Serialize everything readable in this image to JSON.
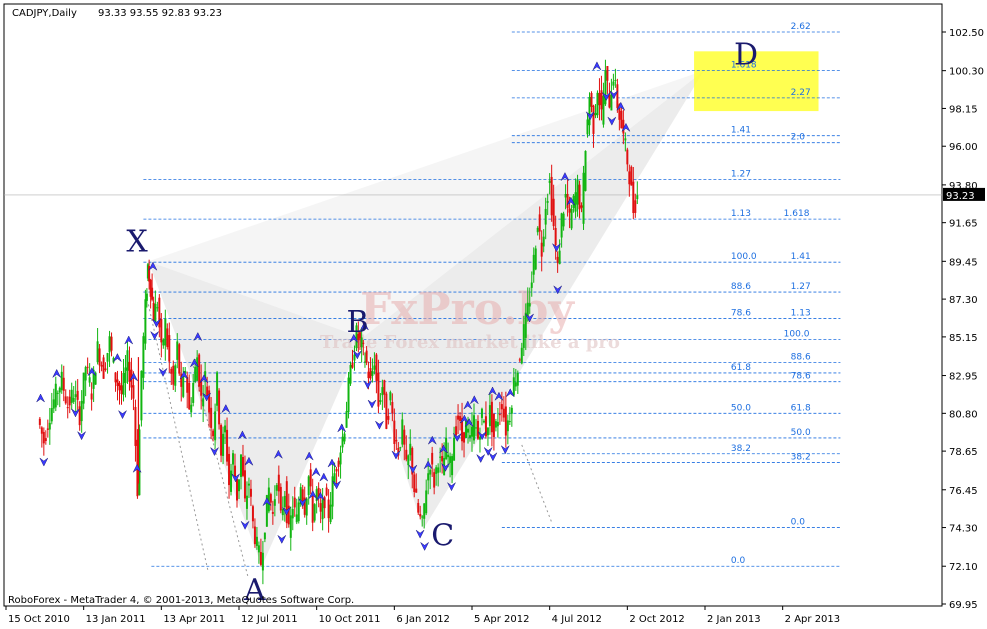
{
  "chart_data": {
    "type": "candlestick",
    "header": {
      "symbol": "CADJPY,Daily",
      "ohlc": "93.33 93.55 92.83 93.23"
    },
    "footer": "RoboForex - MetaTrader 4, © 2001-2013, MetaQuotes Software Corp.",
    "watermark": {
      "main": "FxPro.by",
      "sub": "Trade Forex market like a pro"
    },
    "ylim": [
      69.95,
      103.5
    ],
    "xlim": [
      0,
      940
    ],
    "y_ticks": [
      102.5,
      100.3,
      98.15,
      96.0,
      93.8,
      91.65,
      89.45,
      87.3,
      85.15,
      82.95,
      80.8,
      78.65,
      76.45,
      74.3,
      72.1,
      69.95
    ],
    "y_tick_labels": [
      "102.50",
      "100.30",
      "98.15",
      "96.00",
      "93.80",
      "91.65",
      "89.45",
      "87.30",
      "85.15",
      "82.95",
      "80.80",
      "78.65",
      "76.45",
      "74.30",
      "72.10",
      "69.95"
    ],
    "x_ticks": [
      {
        "label": "15 Oct 2010",
        "x": 0
      },
      {
        "label": "13 Jan 2011",
        "x": 65
      },
      {
        "label": "13 Apr 2011",
        "x": 130
      },
      {
        "label": "12 Jul 2011",
        "x": 195
      },
      {
        "label": "10 Oct 2011",
        "x": 260
      },
      {
        "label": "6 Jan 2012",
        "x": 325
      },
      {
        "label": "5 Apr 2012",
        "x": 390
      },
      {
        "label": "4 Jul 2012",
        "x": 455
      },
      {
        "label": "2 Oct 2012",
        "x": 520
      },
      {
        "label": "2 Jan 2013",
        "x": 585
      },
      {
        "label": "2 Apr 2013",
        "x": 650
      }
    ],
    "current_price": "93.23",
    "wave_points": [
      {
        "label": "X",
        "x": 110,
        "y": 89.45
      },
      {
        "label": "A",
        "x": 224,
        "y": 72.1
      },
      {
        "label": "B",
        "x": 325,
        "y": 85.1
      },
      {
        "label": "C",
        "x": 386,
        "y": 74.2
      },
      {
        "label": "D",
        "x": 668,
        "y": 100.3
      }
    ],
    "fib_lines": [
      {
        "level": 102.5,
        "labels": [
          {
            "text": "2.62",
            "x": 700
          }
        ]
      },
      {
        "level": 100.3,
        "labels": [
          {
            "text": "1.618",
            "x": 640
          }
        ]
      },
      {
        "level": 98.75,
        "labels": [
          {
            "text": "2.27",
            "x": 700
          }
        ]
      },
      {
        "level": 96.6,
        "labels": [
          {
            "text": "1.41",
            "x": 640
          }
        ]
      },
      {
        "level": 96.2,
        "labels": [
          {
            "text": "2.0",
            "x": 700
          }
        ]
      },
      {
        "level": 94.1,
        "labels": [
          {
            "text": "1.27",
            "x": 640
          }
        ]
      },
      {
        "level": 91.85,
        "labels": [
          {
            "text": "1.13",
            "x": 640
          },
          {
            "text": "1.618",
            "x": 693
          }
        ]
      },
      {
        "level": 89.4,
        "labels": [
          {
            "text": "100.0",
            "x": 640
          },
          {
            "text": "1.41",
            "x": 700
          }
        ]
      },
      {
        "level": 87.7,
        "labels": [
          {
            "text": "88.6",
            "x": 640
          },
          {
            "text": "1.27",
            "x": 700
          }
        ]
      },
      {
        "level": 86.2,
        "labels": [
          {
            "text": "78.6",
            "x": 640
          },
          {
            "text": "1.13",
            "x": 700
          }
        ]
      },
      {
        "level": 85.0,
        "labels": [
          {
            "text": "100.0",
            "x": 693
          }
        ]
      },
      {
        "level": 83.7,
        "labels": [
          {
            "text": "88.6",
            "x": 700
          }
        ]
      },
      {
        "level": 83.1,
        "labels": [
          {
            "text": "61.8",
            "x": 640
          }
        ]
      },
      {
        "level": 82.6,
        "labels": [
          {
            "text": "78.6",
            "x": 700
          }
        ]
      },
      {
        "level": 80.8,
        "labels": [
          {
            "text": "50.0",
            "x": 640
          },
          {
            "text": "61.8",
            "x": 700
          }
        ]
      },
      {
        "level": 79.4,
        "labels": [
          {
            "text": "50.0",
            "x": 700
          }
        ]
      },
      {
        "level": 78.5,
        "labels": [
          {
            "text": "38.2",
            "x": 640
          }
        ]
      },
      {
        "level": 78.0,
        "labels": [
          {
            "text": "38.2",
            "x": 700
          }
        ]
      },
      {
        "level": 74.3,
        "labels": [
          {
            "text": "0.0",
            "x": 700
          }
        ]
      },
      {
        "level": 72.1,
        "labels": [
          {
            "text": "0.0",
            "x": 640
          }
        ]
      }
    ],
    "close_series": [
      [
        0,
        80.5
      ],
      [
        6,
        79.2
      ],
      [
        12,
        80.8
      ],
      [
        18,
        81.9
      ],
      [
        24,
        82.7
      ],
      [
        30,
        81.2
      ],
      [
        36,
        82.0
      ],
      [
        42,
        80.7
      ],
      [
        48,
        83.5
      ],
      [
        54,
        82.0
      ],
      [
        60,
        84.5
      ],
      [
        66,
        83.2
      ],
      [
        72,
        84.9
      ],
      [
        78,
        82.8
      ],
      [
        84,
        81.9
      ],
      [
        90,
        83.8
      ],
      [
        96,
        81.7
      ],
      [
        100,
        76.5
      ],
      [
        104,
        83.2
      ],
      [
        108,
        86.8
      ],
      [
        110,
        89.2
      ],
      [
        113,
        88.0
      ],
      [
        116,
        86.4
      ],
      [
        120,
        87.1
      ],
      [
        124,
        84.3
      ],
      [
        128,
        85.9
      ],
      [
        132,
        83.6
      ],
      [
        136,
        82.3
      ],
      [
        140,
        84.6
      ],
      [
        144,
        81.8
      ],
      [
        148,
        83.4
      ],
      [
        152,
        80.9
      ],
      [
        156,
        82.5
      ],
      [
        160,
        84.0
      ],
      [
        164,
        81.6
      ],
      [
        168,
        82.9
      ],
      [
        172,
        81.0
      ],
      [
        176,
        79.8
      ],
      [
        180,
        82.6
      ],
      [
        184,
        78.6
      ],
      [
        188,
        79.9
      ],
      [
        192,
        76.8
      ],
      [
        196,
        78.3
      ],
      [
        200,
        76.1
      ],
      [
        204,
        78.4
      ],
      [
        208,
        75.6
      ],
      [
        212,
        76.9
      ],
      [
        216,
        74.5
      ],
      [
        220,
        73.2
      ],
      [
        224,
        72.3
      ],
      [
        228,
        74.6
      ],
      [
        232,
        76.5
      ],
      [
        236,
        75.0
      ],
      [
        240,
        77.3
      ],
      [
        244,
        74.8
      ],
      [
        248,
        76.4
      ],
      [
        252,
        73.9
      ],
      [
        256,
        75.6
      ],
      [
        260,
        74.7
      ],
      [
        264,
        76.9
      ],
      [
        268,
        75.5
      ],
      [
        272,
        77.2
      ],
      [
        276,
        75.0
      ],
      [
        280,
        76.3
      ],
      [
        284,
        74.9
      ],
      [
        288,
        76.0
      ],
      [
        292,
        75.1
      ],
      [
        296,
        76.8
      ],
      [
        300,
        77.9
      ],
      [
        304,
        78.8
      ],
      [
        308,
        80.1
      ],
      [
        312,
        82.3
      ],
      [
        316,
        83.9
      ],
      [
        320,
        85.3
      ],
      [
        325,
        84.6
      ],
      [
        330,
        83.6
      ],
      [
        334,
        82.5
      ],
      [
        338,
        83.9
      ],
      [
        342,
        81.3
      ],
      [
        346,
        82.4
      ],
      [
        350,
        80.3
      ],
      [
        354,
        81.7
      ],
      [
        358,
        79.6
      ],
      [
        362,
        78.7
      ],
      [
        366,
        79.9
      ],
      [
        370,
        77.6
      ],
      [
        374,
        78.8
      ],
      [
        378,
        76.5
      ],
      [
        382,
        75.1
      ],
      [
        386,
        74.4
      ],
      [
        390,
        76.7
      ],
      [
        394,
        78.1
      ],
      [
        398,
        76.9
      ],
      [
        402,
        78.3
      ],
      [
        406,
        77.6
      ],
      [
        410,
        78.9
      ],
      [
        414,
        77.8
      ],
      [
        418,
        79.6
      ],
      [
        422,
        80.6
      ],
      [
        426,
        79.3
      ],
      [
        430,
        80.1
      ],
      [
        434,
        79.1
      ],
      [
        438,
        80.4
      ],
      [
        442,
        79.4
      ],
      [
        446,
        80.7
      ],
      [
        450,
        79.8
      ],
      [
        454,
        80.9
      ],
      [
        458,
        79.5
      ],
      [
        462,
        80.6
      ],
      [
        466,
        81.5
      ],
      [
        470,
        79.9
      ],
      [
        474,
        80.8
      ],
      [
        478,
        82.6
      ],
      [
        482,
        83.3
      ],
      [
        486,
        84.9
      ],
      [
        490,
        86.0
      ],
      [
        494,
        87.4
      ],
      [
        498,
        89.5
      ],
      [
        502,
        91.8
      ],
      [
        506,
        90.1
      ],
      [
        510,
        92.8
      ],
      [
        514,
        93.9
      ],
      [
        518,
        91.4
      ],
      [
        522,
        89.0
      ],
      [
        526,
        91.9
      ],
      [
        530,
        93.1
      ],
      [
        534,
        91.7
      ],
      [
        538,
        92.8
      ],
      [
        542,
        93.7
      ],
      [
        546,
        92.0
      ],
      [
        550,
        96.1
      ],
      [
        554,
        98.9
      ],
      [
        558,
        97.2
      ],
      [
        562,
        99.4
      ],
      [
        566,
        97.8
      ],
      [
        570,
        100.0
      ],
      [
        574,
        98.6
      ],
      [
        578,
        100.1
      ],
      [
        582,
        98.4
      ],
      [
        586,
        97.1
      ],
      [
        590,
        95.9
      ],
      [
        594,
        94.4
      ],
      [
        598,
        92.4
      ],
      [
        602,
        93.2
      ]
    ]
  }
}
